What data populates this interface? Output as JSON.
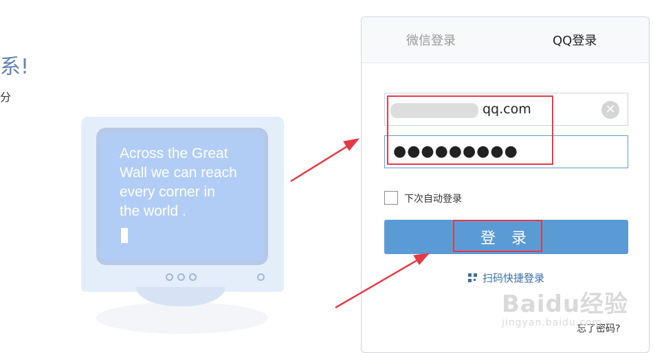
{
  "left": {
    "headline": "系!",
    "subline": "分",
    "screen_lines": [
      "Across the Great",
      "Wall we can reach",
      "every corner in",
      "the world ."
    ]
  },
  "tabs": [
    {
      "label": "微信登录",
      "active": false
    },
    {
      "label": "QQ登录",
      "active": true
    }
  ],
  "form": {
    "account_value": "qq.com",
    "clear_icon": "✕",
    "password_mask": "●●●●●●●●●",
    "remember_label": "下次自动登录",
    "login_button": "登 录",
    "qr_link": "扫码快捷登录",
    "forgot_link": "忘了密码?"
  },
  "watermark": {
    "brand": "Baidu经验",
    "url": "jingyan.baidu.com"
  },
  "colors": {
    "accent": "#5b9bd5",
    "annotation": "#e63946",
    "headline": "#5f84b3"
  }
}
